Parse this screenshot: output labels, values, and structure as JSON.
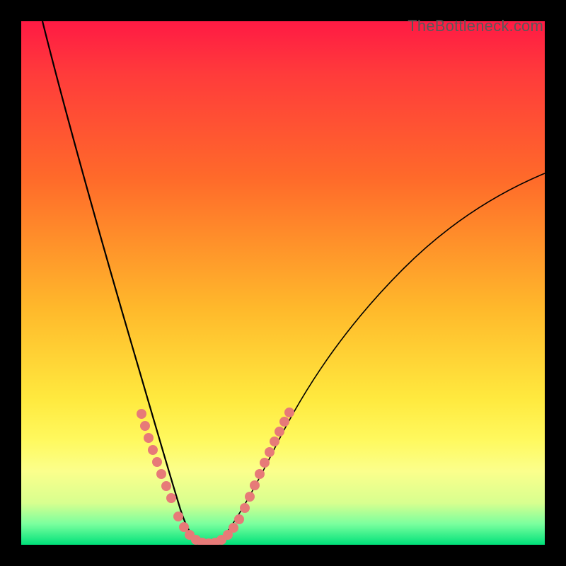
{
  "watermark": "TheBottleneck.com",
  "colors": {
    "frame": "#000000",
    "gradient_top": "#ff1a44",
    "gradient_bottom": "#00e17a",
    "curve": "#000000",
    "beads": "#e77a78"
  },
  "chart_data": {
    "type": "line",
    "title": "",
    "xlabel": "",
    "ylabel": "",
    "xlim": [
      0,
      100
    ],
    "ylim": [
      0,
      100
    ],
    "description": "Bottleneck curve: steep descent from top-left to a narrow minimum near x≈33, then a slow rise to the right edge. Background hue encodes bottleneck severity (red=high, green=low). Salmon beads highlight points near the valley of the curve.",
    "series": [
      {
        "name": "bottleneck-curve",
        "x": [
          4,
          6,
          8,
          10,
          12,
          14,
          16,
          18,
          20,
          22,
          24,
          26,
          28,
          29,
          30,
          31,
          32,
          33,
          34,
          35,
          36,
          38,
          40,
          42,
          45,
          48,
          52,
          56,
          60,
          65,
          70,
          76,
          82,
          88,
          94,
          100
        ],
        "y": [
          100,
          94,
          88,
          82,
          76,
          70,
          63,
          56,
          49,
          42,
          35,
          27,
          18,
          13,
          8,
          4,
          2,
          1,
          1.5,
          3,
          5,
          9,
          13,
          17,
          22,
          27,
          32,
          37,
          42,
          47,
          52,
          57,
          61,
          65,
          68,
          71
        ]
      }
    ],
    "annotations": {
      "beads_left": {
        "x": [
          22,
          22.8,
          23.6,
          24.4,
          25.2,
          26,
          26.8,
          27.6
        ],
        "y": [
          42,
          39,
          36,
          33,
          30,
          27,
          24,
          21
        ]
      },
      "beads_min": {
        "x": [
          28.5,
          29.3,
          30.1,
          30.9,
          31.7,
          32.5,
          33.3,
          34.1,
          34.9,
          35.7,
          36.5
        ],
        "y": [
          10,
          7,
          5,
          3,
          2,
          1,
          1,
          2,
          3,
          5,
          7
        ]
      },
      "beads_right": {
        "x": [
          37.5,
          38.3,
          39.1,
          39.9,
          40.7,
          41.5,
          42.3,
          43.1,
          43.9,
          44.7
        ],
        "y": [
          11,
          13,
          15,
          17,
          19,
          21,
          23,
          25,
          27,
          29
        ]
      }
    }
  }
}
